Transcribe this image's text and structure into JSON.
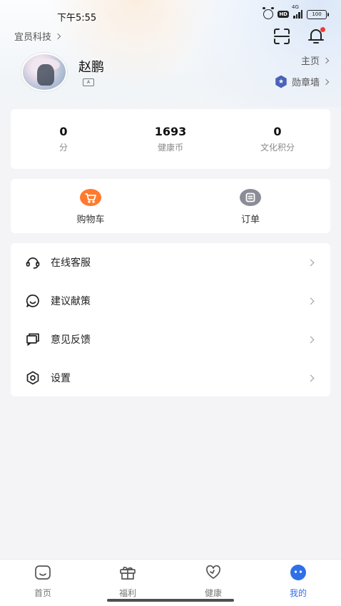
{
  "status_bar": {
    "time": "下午5:55",
    "network": "4G",
    "hd": "HD",
    "battery": "100"
  },
  "header": {
    "company": "宜员科技"
  },
  "profile": {
    "name": "赵鹏",
    "id_badge": "A",
    "homepage_label": "主页",
    "medal_wall_label": "勋章墙"
  },
  "stats": [
    {
      "value": "0",
      "label": "分"
    },
    {
      "value": "1693",
      "label": "健康币"
    },
    {
      "value": "0",
      "label": "文化积分"
    }
  ],
  "orders": [
    {
      "label": "购物车",
      "icon": "cart-icon",
      "color": "#ff7a2e"
    },
    {
      "label": "订单",
      "icon": "order-icon",
      "color": "#8a8d96"
    }
  ],
  "menu": [
    {
      "label": "在线客服",
      "icon": "headset-icon"
    },
    {
      "label": "建议献策",
      "icon": "chat-smile-icon"
    },
    {
      "label": "意见反馈",
      "icon": "feedback-icon"
    },
    {
      "label": "设置",
      "icon": "settings-icon"
    }
  ],
  "tabs": [
    {
      "label": "首页",
      "icon": "home-icon",
      "active": false
    },
    {
      "label": "福利",
      "icon": "gift-icon",
      "active": false
    },
    {
      "label": "健康",
      "icon": "heart-icon",
      "active": false
    },
    {
      "label": "我的",
      "icon": "profile-icon",
      "active": true
    }
  ],
  "colors": {
    "accent": "#2f6fe8",
    "notification_dot": "#f03a3a",
    "medal": "#4a62b8"
  }
}
